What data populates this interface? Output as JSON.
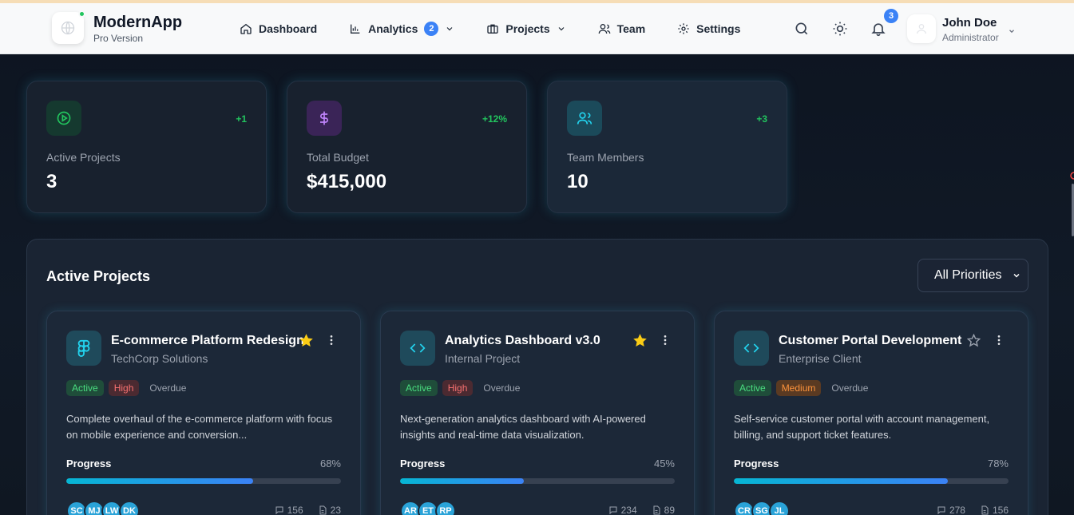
{
  "app": {
    "name": "ModernApp",
    "subtitle": "Pro Version"
  },
  "nav": {
    "items": [
      {
        "label": "Dashboard",
        "icon": "home-icon"
      },
      {
        "label": "Analytics",
        "icon": "bar-chart-icon",
        "badge": "2"
      },
      {
        "label": "Projects",
        "icon": "briefcase-icon"
      },
      {
        "label": "Team",
        "icon": "users-icon"
      },
      {
        "label": "Settings",
        "icon": "gear-icon"
      }
    ]
  },
  "header": {
    "notifications_count": "3"
  },
  "user": {
    "name": "John Doe",
    "role": "Administrator"
  },
  "stats": [
    {
      "label": "Active Projects",
      "value": "3",
      "delta": "+1",
      "icon": "play-circle-icon",
      "color": "#22c55e"
    },
    {
      "label": "Total Budget",
      "value": "$415,000",
      "delta": "+12%",
      "icon": "dollar-icon",
      "color": "#a855f7"
    },
    {
      "label": "Team Members",
      "value": "10",
      "delta": "+3",
      "icon": "users-icon",
      "color": "#22d3ee"
    }
  ],
  "panel": {
    "title": "Active Projects",
    "filter": "All Priorities"
  },
  "projects": [
    {
      "title": "E-commerce Platform Redesign",
      "client": "TechCorp Solutions",
      "starred": true,
      "status": "Active",
      "priority": "High",
      "due": "Overdue",
      "description": "Complete overhaul of the e-commerce platform with focus on mobile experience and conversion...",
      "progress_label": "Progress",
      "progress": 68,
      "progress_text": "68%",
      "members": [
        "SC",
        "MJ",
        "LW",
        "DK"
      ],
      "comments": "156",
      "files": "23"
    },
    {
      "title": "Analytics Dashboard v3.0",
      "client": "Internal Project",
      "starred": true,
      "status": "Active",
      "priority": "High",
      "due": "Overdue",
      "description": "Next-generation analytics dashboard with AI-powered insights and real-time data visualization.",
      "progress_label": "Progress",
      "progress": 45,
      "progress_text": "45%",
      "members": [
        "AR",
        "ET",
        "RP"
      ],
      "comments": "234",
      "files": "89"
    },
    {
      "title": "Customer Portal Development",
      "client": "Enterprise Client",
      "starred": false,
      "status": "Active",
      "priority": "Medium",
      "due": "Overdue",
      "description": "Self-service customer portal with account management, billing, and support ticket features.",
      "progress_label": "Progress",
      "progress": 78,
      "progress_text": "78%",
      "members": [
        "CR",
        "SG",
        "JL"
      ],
      "comments": "278",
      "files": "156"
    }
  ]
}
